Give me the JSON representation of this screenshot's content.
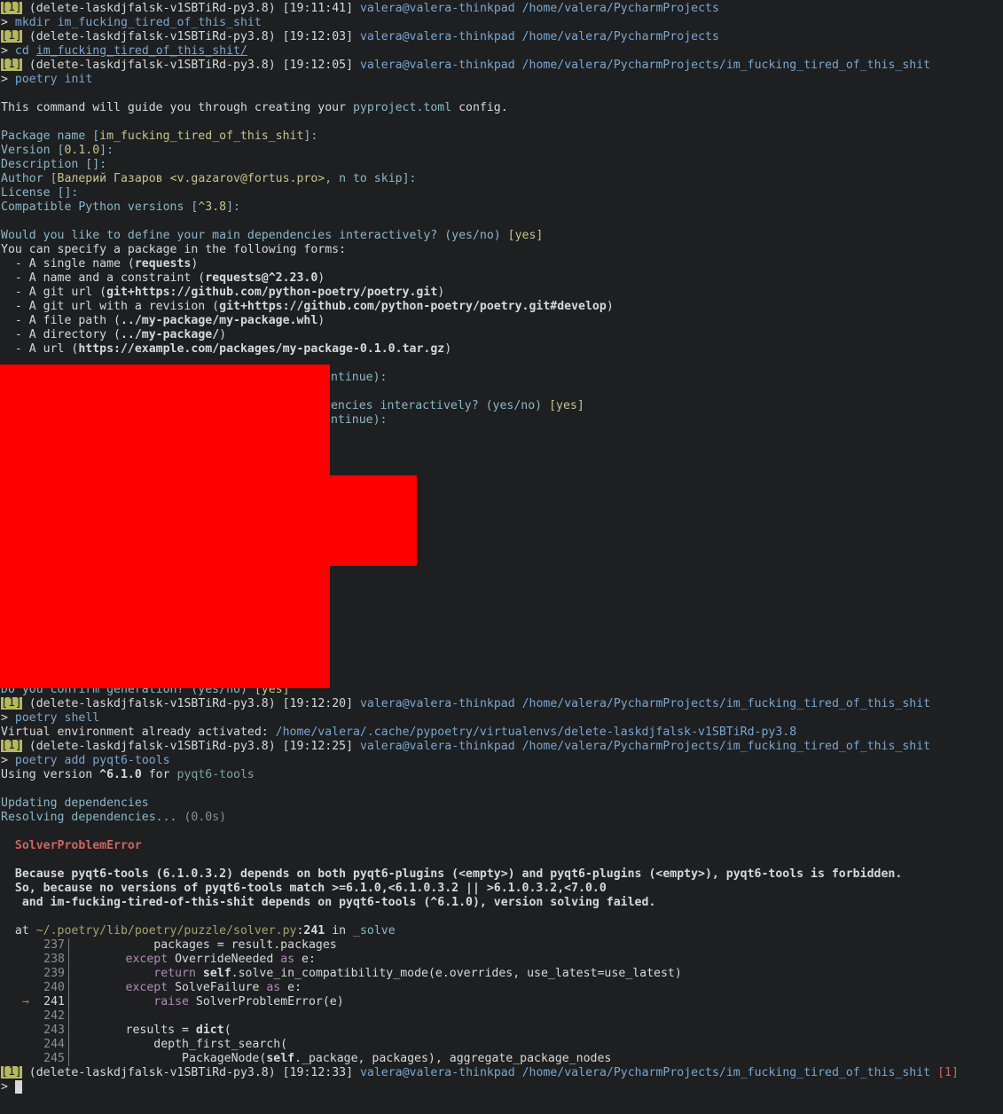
{
  "prompt": {
    "status_box": "[1]",
    "env": "(delete-laskdjfalsk-v1SBTiRd-py3.8)",
    "user_host": "valera@valera-thinkpad",
    "projects_dir": "/home/valera/PycharmProjects",
    "project_dir": "/home/valera/PycharmProjects/im_fucking_tired_of_this_shit",
    "exit_code": "[1]",
    "arrow": ">"
  },
  "times": {
    "t1": "[19:11:41]",
    "t2": "[19:12:03]",
    "t3": "[19:12:05]",
    "t4": "[19:12:20]",
    "t5": "[19:12:25]",
    "t6": "[19:12:33]"
  },
  "commands": {
    "mkdir": "mkdir",
    "mkdir_arg": "im_fucking_tired_of_this_shit",
    "cd": "cd",
    "cd_arg": "im_fucking_tired_of_this_shit/",
    "poetry": "poetry",
    "init": "init",
    "shell": "shell",
    "add": "add",
    "pkg": "pyqt6-tools"
  },
  "init": {
    "intro_1": "This command will guide you through creating your ",
    "intro_file": "pyproject.toml",
    "intro_2": " config.",
    "pkg_name_label": "Package name [",
    "pkg_name_val": "im_fucking_tired_of_this_shit",
    "pkg_name_end": "]:",
    "version_label": "Version [",
    "version_val": "0.1.0",
    "version_end": "]:",
    "desc": "Description []:",
    "author_label": "Author [",
    "author_val": "Валерий Газаров <v.gazarov@fortus.pro>",
    "author_end": ", n to skip]:",
    "license": "License []:",
    "compat_label": "Compatible Python versions [",
    "compat_val": "^3.8",
    "compat_end": "]:",
    "define_deps_q": "Would you like to define your main dependencies interactively? (yes/no) ",
    "yes": "[yes]",
    "specify": "You can specify a package in the following forms:",
    "forms": [
      {
        "pre": "  - A single name (",
        "bold": "requests",
        "post": ")"
      },
      {
        "pre": "  - A name and a constraint (",
        "bold": "requests@^2.23.0",
        "post": ")"
      },
      {
        "pre": "  - A git url (",
        "bold": "git+https://github.com/python-poetry/poetry.git",
        "post": ")"
      },
      {
        "pre": "  - A git url with a revision (",
        "bold": "git+https://github.com/python-poetry/poetry.git#develop",
        "post": ")"
      },
      {
        "pre": "  - A file path (",
        "bold": "../my-package/my-package.whl",
        "post": ")"
      },
      {
        "pre": "  - A directory (",
        "bold": "../my-package/",
        "post": ")"
      },
      {
        "pre": "  - A url (",
        "bold": "https://example.com/packages/my-package-0.1.0.tar.gz",
        "post": ")"
      }
    ],
    "partial_1": "ontinue):",
    "partial_2": "dencies interactively? (yes/no) ",
    "partial_3": "ontinue):",
    "confirm_q": "Do you confirm generation? (yes/no) "
  },
  "shell_out": {
    "label": "Virtual environment already activated: ",
    "path": "/home/valera/.cache/pypoetry/virtualenvs/delete-laskdjfalsk-v1SBTiRd-py3.8"
  },
  "add_out": {
    "using_1": "Using version ",
    "using_ver": "^6.1.0",
    "using_2": " for ",
    "updating": "Updating dependencies",
    "resolving": "Resolving dependencies... ",
    "resolving_time": "(0.0s)",
    "error_name": "SolverProblemError",
    "err_1": "  Because pyqt6-tools (6.1.0.3.2) depends on both pyqt6-plugins (<empty>) and pyqt6-plugins (<empty>), pyqt6-tools is forbidden.",
    "err_2": "  So, because no versions of pyqt6-tools match >=6.1.0,<6.1.0.3.2 || >6.1.0.3.2,<7.0.0",
    "err_3": "   and im-fucking-tired-of-this-shit depends on pyqt6-tools (^6.1.0), version solving failed.",
    "at": "  at ",
    "at_path": "~/.poetry/lib/poetry/puzzle/solver.py",
    "at_colon": ":",
    "at_line": "241",
    "at_in": " in ",
    "at_func": "_solve"
  },
  "code": [
    {
      "num": "237",
      "marker": "",
      "parts": [
        {
          "t": "            packages = result.packages",
          "c": "c-white"
        }
      ]
    },
    {
      "num": "238",
      "marker": "",
      "parts": [
        {
          "t": "        ",
          "c": "c-white"
        },
        {
          "t": "except",
          "c": "c-magenta"
        },
        {
          "t": " OverrideNeeded ",
          "c": "c-white"
        },
        {
          "t": "as",
          "c": "c-magenta"
        },
        {
          "t": " e:",
          "c": "c-white"
        }
      ]
    },
    {
      "num": "239",
      "marker": "",
      "parts": [
        {
          "t": "            ",
          "c": "c-white"
        },
        {
          "t": "return",
          "c": "c-magenta"
        },
        {
          "t": " ",
          "c": "c-white"
        },
        {
          "t": "self",
          "c": "c-white bold"
        },
        {
          "t": ".solve_in_compatibility_mode(e.overrides, use_latest=use_latest)",
          "c": "c-white"
        }
      ]
    },
    {
      "num": "240",
      "marker": "",
      "parts": [
        {
          "t": "        ",
          "c": "c-white"
        },
        {
          "t": "except",
          "c": "c-magenta"
        },
        {
          "t": " SolveFailure ",
          "c": "c-white"
        },
        {
          "t": "as",
          "c": "c-magenta"
        },
        {
          "t": " e:",
          "c": "c-white"
        }
      ]
    },
    {
      "num": "241",
      "marker": "→",
      "parts": [
        {
          "t": "            ",
          "c": "c-white"
        },
        {
          "t": "raise",
          "c": "c-magenta"
        },
        {
          "t": " SolverProblemError(e)",
          "c": "c-white"
        }
      ]
    },
    {
      "num": "242",
      "marker": "",
      "parts": []
    },
    {
      "num": "243",
      "marker": "",
      "parts": [
        {
          "t": "        results = ",
          "c": "c-white"
        },
        {
          "t": "dict",
          "c": "c-white bold"
        },
        {
          "t": "(",
          "c": "c-white"
        }
      ]
    },
    {
      "num": "244",
      "marker": "",
      "parts": [
        {
          "t": "            depth_first_search(",
          "c": "c-white"
        }
      ]
    },
    {
      "num": "245",
      "marker": "",
      "parts": [
        {
          "t": "                PackageNode(",
          "c": "c-white"
        },
        {
          "t": "self",
          "c": "c-white bold"
        },
        {
          "t": "._package, packages), aggregate_package_nodes",
          "c": "c-white"
        }
      ]
    }
  ],
  "colors": {
    "background": "#1d1f21",
    "foreground": "#d8d8d8",
    "status_box": "#b7b85e",
    "path_blue": "#7ba6cf",
    "error_red": "#d1645f",
    "keyword_magenta": "#b18ab8",
    "redaction": "#ff0000"
  }
}
